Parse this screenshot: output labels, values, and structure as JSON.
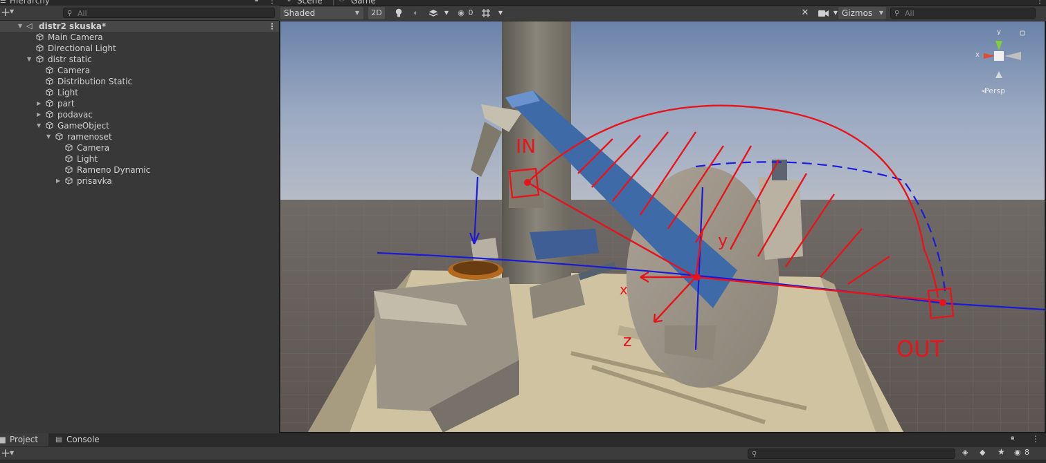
{
  "hierarchy": {
    "title": "Hierarchy",
    "search_placeholder": "All",
    "scene_name": "distr2 skuska*",
    "items": [
      {
        "label": "Main Camera"
      },
      {
        "label": "Directional Light"
      },
      {
        "label": "distr static"
      },
      {
        "label": "Camera"
      },
      {
        "label": "Distribution Static"
      },
      {
        "label": "Light"
      },
      {
        "label": "part"
      },
      {
        "label": "podavac"
      },
      {
        "label": "GameObject"
      },
      {
        "label": "ramenoset"
      },
      {
        "label": "Camera"
      },
      {
        "label": "Light"
      },
      {
        "label": "Rameno Dynamic"
      },
      {
        "label": "prisavka"
      }
    ]
  },
  "scene_tabs": {
    "scene": "Scene",
    "game": "Game"
  },
  "scene_toolbar": {
    "shading": "Shaded",
    "mode_2d": "2D",
    "hidden_count": "0",
    "gizmos": "Gizmos",
    "search_placeholder": "All"
  },
  "gizmo": {
    "y_label": "y",
    "x_label": "x",
    "projection": "Persp"
  },
  "annotations": {
    "in_label": "IN",
    "out_label": "OUT",
    "axis_x": "x",
    "axis_y": "y",
    "axis_z": "z"
  },
  "bottom": {
    "project_tab": "Project",
    "console_tab": "Console",
    "hidden_count": "8"
  },
  "colors": {
    "annotation_red": "#e8141c",
    "annotation_blue": "#1a1ad8",
    "arm_blue": "#3f6aa8"
  }
}
